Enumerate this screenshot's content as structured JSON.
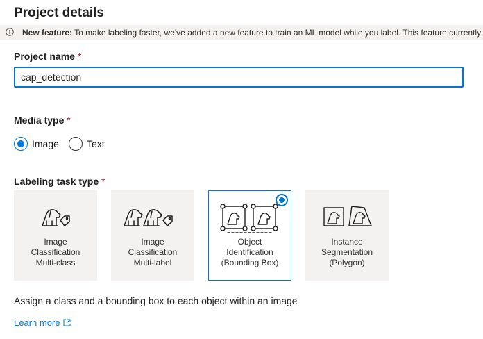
{
  "header": {
    "title": "Project details"
  },
  "banner": {
    "icon": "info-icon",
    "bold": "New feature:",
    "text": " To make labeling faster, we've added a new feature to train an ML model while you label. This feature currently s"
  },
  "project_name": {
    "label": "Project name",
    "required_mark": "*",
    "value": "cap_detection"
  },
  "media_type": {
    "label": "Media type",
    "required_mark": "*",
    "options": [
      {
        "label": "Image",
        "selected": true
      },
      {
        "label": "Text",
        "selected": false
      }
    ]
  },
  "task_type": {
    "label": "Labeling task type",
    "required_mark": "*",
    "cards": [
      {
        "label": "Image\nClassification\nMulti-class",
        "icon": "dog-tag-icon",
        "selected": false
      },
      {
        "label": "Image\nClassification\nMulti-label",
        "icon": "dogs-tag-icon",
        "selected": false
      },
      {
        "label": "Object\nIdentification\n(Bounding Box)",
        "icon": "bounding-box-icon",
        "selected": true
      },
      {
        "label": "Instance\nSegmentation\n(Polygon)",
        "icon": "polygon-icon",
        "selected": false
      }
    ],
    "description": "Assign a class and a bounding box to each object within an image"
  },
  "learn_more": {
    "label": "Learn more",
    "icon": "external-link-icon"
  },
  "colors": {
    "accent": "#0078d4",
    "required": "#a4262c",
    "card_bg": "#f3f2f1",
    "banner_bg": "#f3f2f1"
  }
}
